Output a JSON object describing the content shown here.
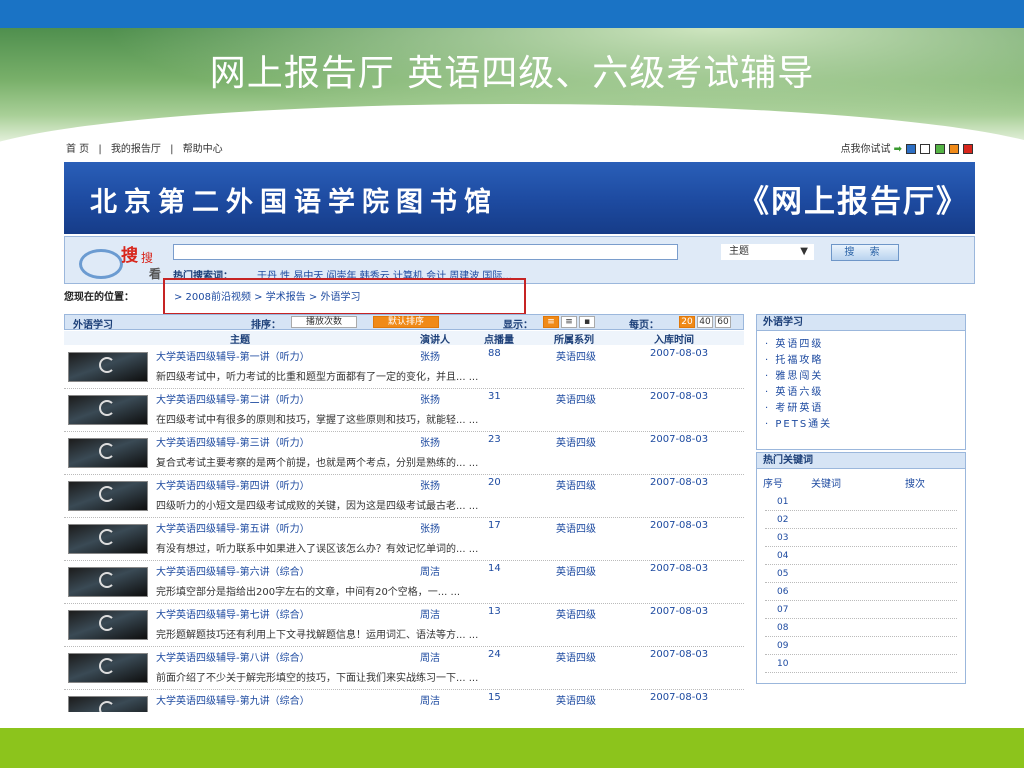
{
  "slide_title": "网上报告厅 英语四级、六级考试辅导",
  "colors": {
    "top_bar": "#1a73c5",
    "bottom_bar": "#8cc41c",
    "highlight_box": "#c62424",
    "sort_active": "#f08a18"
  },
  "topnav": [
    "首 页",
    "|",
    "我的报告厅",
    "|",
    "帮助中心"
  ],
  "tryit": {
    "label": "点我你试试",
    "icon": "arrow-right-icon"
  },
  "library_banner": {
    "name": "北京第二外国语学院图书馆",
    "slogan": "《网上报告厅》"
  },
  "search": {
    "logo_big": "搜",
    "logo_small": "搜",
    "logo_sub": "看",
    "input_value": "",
    "select_value": "主题",
    "button_label": "搜 索",
    "hot_label": "热门搜索词：",
    "hot_words": "于丹 性 易中天 阎崇年 韩秀云 计算机 会计 周建波 国际..."
  },
  "location": {
    "label": "您现在的位置：",
    "path": "> 2008前沿视频 > 学术报告 > 外语学习"
  },
  "list": {
    "section_title": "外语学习",
    "sort_label": "排序：",
    "sort_options": [
      "播放次数",
      "默认排序"
    ],
    "display_label": "显示：",
    "perpage_label": "每页：",
    "perpage_options": [
      "20",
      "40",
      "60"
    ],
    "columns": [
      "主题",
      "演讲人",
      "点播量",
      "所属系列",
      "入库时间"
    ],
    "rows": [
      {
        "title": "大学英语四级辅导-第一讲（听力）",
        "speaker": "张扬",
        "views": "88",
        "series": "英语四级",
        "date": "2007-08-03",
        "desc": "新四级考试中，听力考试的比重和题型方面都有了一定的变化，并且... ..."
      },
      {
        "title": "大学英语四级辅导-第二讲（听力）",
        "speaker": "张扬",
        "views": "31",
        "series": "英语四级",
        "date": "2007-08-03",
        "desc": "在四级考试中有很多的原则和技巧，掌握了这些原则和技巧，就能轻... ..."
      },
      {
        "title": "大学英语四级辅导-第三讲（听力）",
        "speaker": "张扬",
        "views": "23",
        "series": "英语四级",
        "date": "2007-08-03",
        "desc": "复合式考试主要考察的是两个前提，也就是两个考点，分别是熟练的... ..."
      },
      {
        "title": "大学英语四级辅导-第四讲（听力）",
        "speaker": "张扬",
        "views": "20",
        "series": "英语四级",
        "date": "2007-08-03",
        "desc": "四级听力的小短文是四级考试成败的关键，因为这是四级考试最古老... ..."
      },
      {
        "title": "大学英语四级辅导-第五讲（听力）",
        "speaker": "张扬",
        "views": "17",
        "series": "英语四级",
        "date": "2007-08-03",
        "desc": "有没有想过，听力联系中如果进入了误区该怎么办？有效记忆单词的... ..."
      },
      {
        "title": "大学英语四级辅导-第六讲（综合）",
        "speaker": "周洁",
        "views": "14",
        "series": "英语四级",
        "date": "2007-08-03",
        "desc": "完形填空部分是指给出200字左右的文章，中间有20个空格，一... ..."
      },
      {
        "title": "大学英语四级辅导-第七讲（综合）",
        "speaker": "周洁",
        "views": "13",
        "series": "英语四级",
        "date": "2007-08-03",
        "desc": "完形题解题技巧还有利用上下文寻找解题信息！运用词汇、语法等方... ..."
      },
      {
        "title": "大学英语四级辅导-第八讲（综合）",
        "speaker": "周洁",
        "views": "24",
        "series": "英语四级",
        "date": "2007-08-03",
        "desc": "前面介绍了不少关于解完形填空的技巧，下面让我们来实战练习一下... ..."
      },
      {
        "title": "大学英语四级辅导-第九讲（综合）",
        "speaker": "周洁",
        "views": "15",
        "series": "英语四级",
        "date": "2007-08-03",
        "desc": ""
      }
    ]
  },
  "sidebar": {
    "categories_title": "外语学习",
    "categories": [
      "· 英语四级",
      "· 托福攻略",
      "· 雅思闯关",
      "· 英语六级",
      "· 考研英语",
      "· PETS通关"
    ],
    "keywords_title": "热门关键词",
    "keywords_columns": [
      "序号",
      "关键词",
      "搜次"
    ],
    "keywords": [
      "01",
      "02",
      "03",
      "04",
      "05",
      "06",
      "07",
      "08",
      "09",
      "10"
    ]
  }
}
